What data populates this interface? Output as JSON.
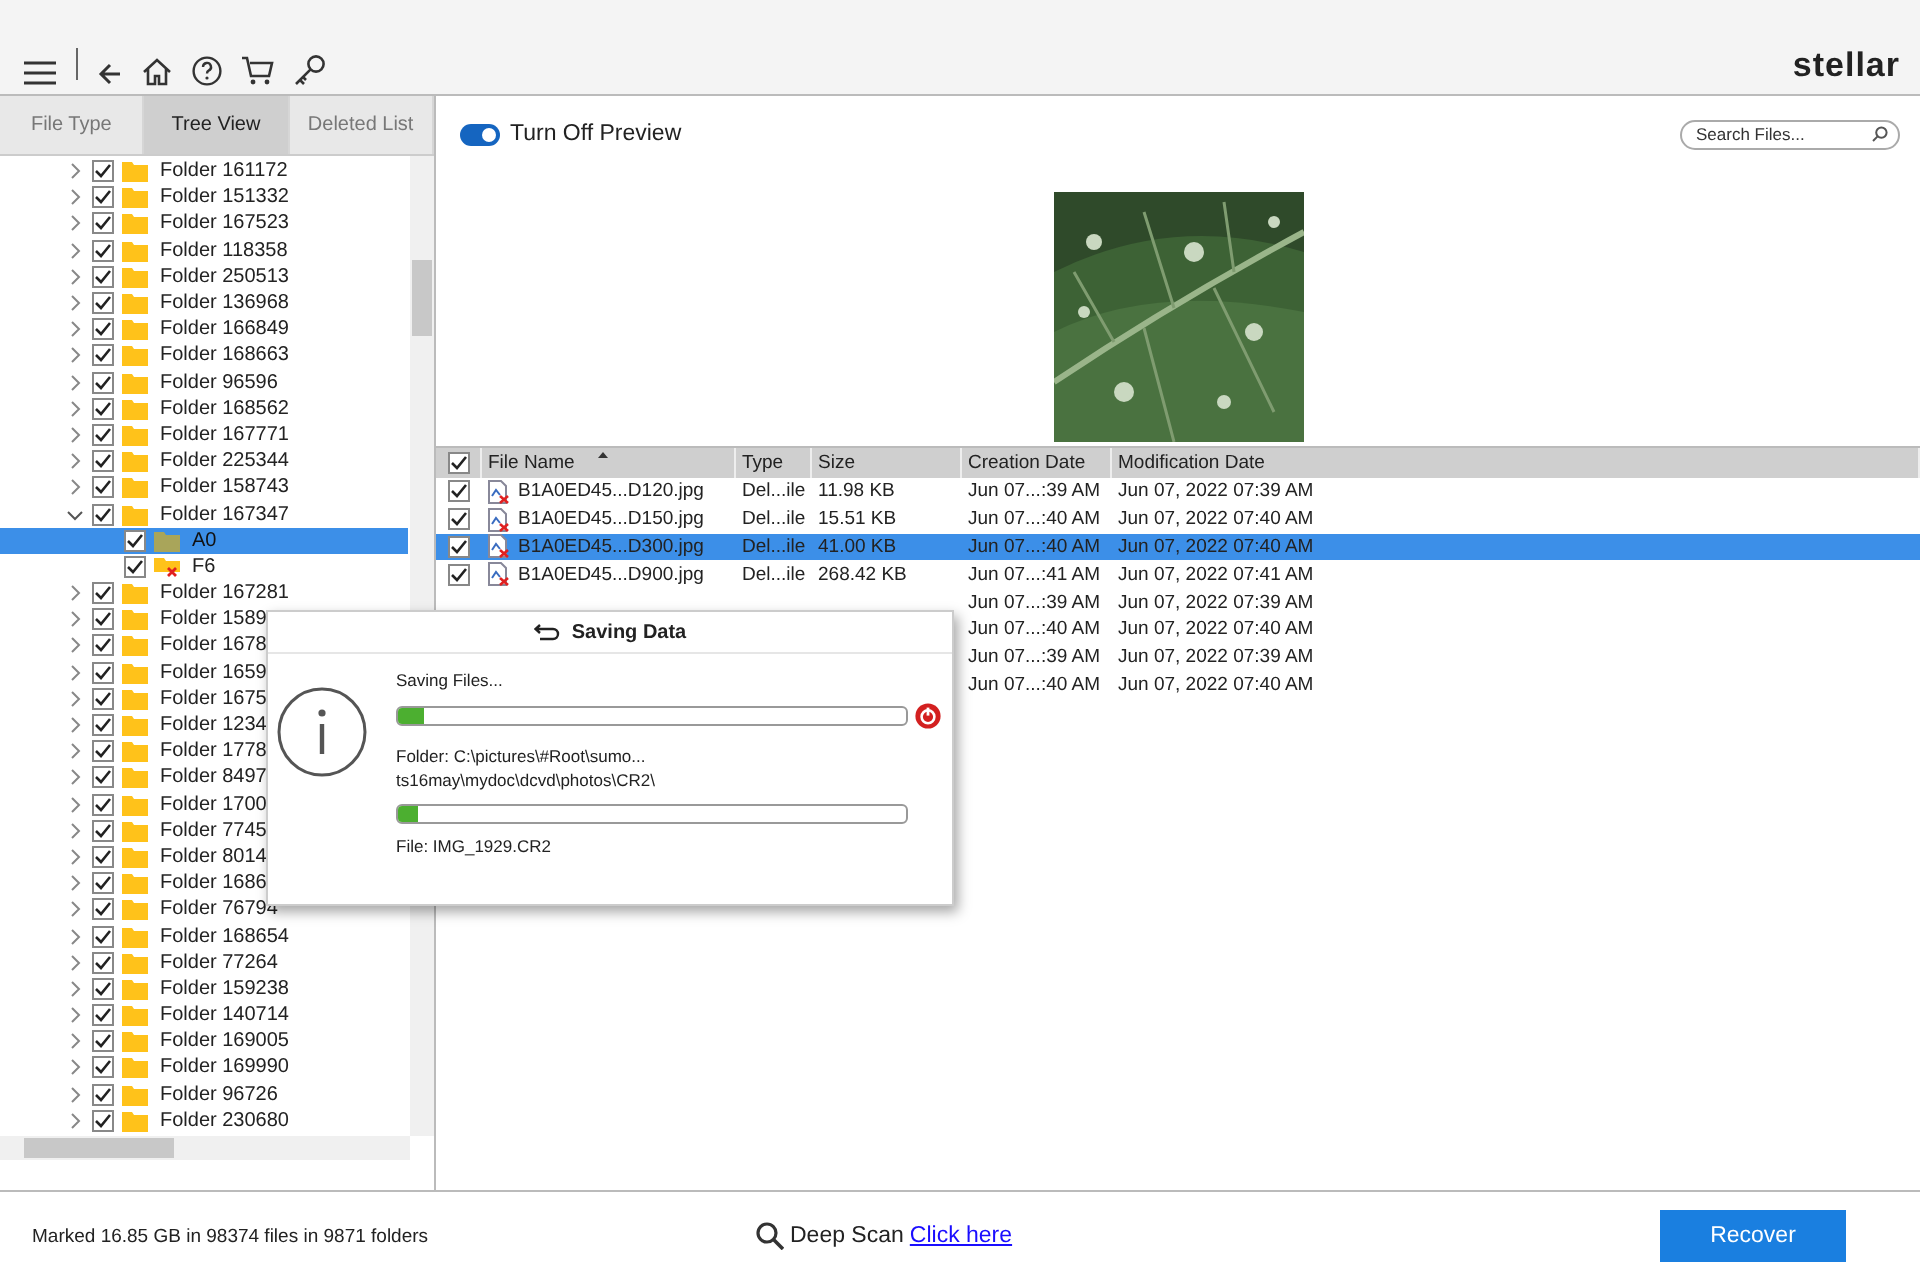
{
  "tabs": [
    {
      "label": "File Type",
      "selected": false
    },
    {
      "label": "Tree View",
      "selected": true
    },
    {
      "label": "Deleted List",
      "selected": false
    }
  ],
  "logo": "stellar",
  "tree": [
    {
      "label": "Folder 161172",
      "checked": true,
      "expanded": false,
      "selected": false,
      "kind": "folder"
    },
    {
      "label": "Folder 151332",
      "checked": true,
      "expanded": false,
      "selected": false,
      "kind": "folder"
    },
    {
      "label": "Folder 167523",
      "checked": true,
      "expanded": false,
      "selected": false,
      "kind": "folder"
    },
    {
      "label": "Folder 118358",
      "checked": true,
      "expanded": false,
      "selected": false,
      "kind": "folder"
    },
    {
      "label": "Folder 250513",
      "checked": true,
      "expanded": false,
      "selected": false,
      "kind": "folder"
    },
    {
      "label": "Folder 136968",
      "checked": true,
      "expanded": false,
      "selected": false,
      "kind": "folder"
    },
    {
      "label": "Folder 166849",
      "checked": true,
      "expanded": false,
      "selected": false,
      "kind": "folder"
    },
    {
      "label": "Folder 168663",
      "checked": true,
      "expanded": false,
      "selected": false,
      "kind": "folder"
    },
    {
      "label": "Folder 96596",
      "checked": true,
      "expanded": false,
      "selected": false,
      "kind": "folder"
    },
    {
      "label": "Folder 168562",
      "checked": true,
      "expanded": false,
      "selected": false,
      "kind": "folder"
    },
    {
      "label": "Folder 167771",
      "checked": true,
      "expanded": false,
      "selected": false,
      "kind": "folder"
    },
    {
      "label": "Folder 225344",
      "checked": true,
      "expanded": false,
      "selected": false,
      "kind": "folder"
    },
    {
      "label": "Folder 158743",
      "checked": true,
      "expanded": false,
      "selected": false,
      "kind": "folder"
    },
    {
      "label": "Folder 167347",
      "checked": true,
      "expanded": true,
      "selected": false,
      "kind": "folder",
      "children": [
        {
          "label": "A0",
          "checked": true,
          "selected": true,
          "kind": "folder"
        },
        {
          "label": "F6",
          "checked": true,
          "selected": false,
          "kind": "deleted"
        }
      ]
    },
    {
      "label": "Folder 167281",
      "checked": true,
      "expanded": false,
      "selected": false,
      "kind": "folder"
    },
    {
      "label": "Folder 1589",
      "checked": true,
      "expanded": false,
      "selected": false,
      "kind": "folder"
    },
    {
      "label": "Folder 1678",
      "checked": true,
      "expanded": false,
      "selected": false,
      "kind": "folder"
    },
    {
      "label": "Folder 1659",
      "checked": true,
      "expanded": false,
      "selected": false,
      "kind": "folder"
    },
    {
      "label": "Folder 1675",
      "checked": true,
      "expanded": false,
      "selected": false,
      "kind": "folder"
    },
    {
      "label": "Folder 1234",
      "checked": true,
      "expanded": false,
      "selected": false,
      "kind": "folder"
    },
    {
      "label": "Folder 1778",
      "checked": true,
      "expanded": false,
      "selected": false,
      "kind": "folder"
    },
    {
      "label": "Folder 8497",
      "checked": true,
      "expanded": false,
      "selected": false,
      "kind": "folder"
    },
    {
      "label": "Folder 1700",
      "checked": true,
      "expanded": false,
      "selected": false,
      "kind": "folder"
    },
    {
      "label": "Folder 7745",
      "checked": true,
      "expanded": false,
      "selected": false,
      "kind": "folder"
    },
    {
      "label": "Folder 8014",
      "checked": true,
      "expanded": false,
      "selected": false,
      "kind": "folder"
    },
    {
      "label": "Folder 1686",
      "checked": true,
      "expanded": false,
      "selected": false,
      "kind": "folder"
    },
    {
      "label": "Folder 76794",
      "checked": true,
      "expanded": false,
      "selected": false,
      "kind": "folder"
    },
    {
      "label": "Folder 168654",
      "checked": true,
      "expanded": false,
      "selected": false,
      "kind": "folder"
    },
    {
      "label": "Folder 77264",
      "checked": true,
      "expanded": false,
      "selected": false,
      "kind": "folder"
    },
    {
      "label": "Folder 159238",
      "checked": true,
      "expanded": false,
      "selected": false,
      "kind": "folder"
    },
    {
      "label": "Folder 140714",
      "checked": true,
      "expanded": false,
      "selected": false,
      "kind": "folder"
    },
    {
      "label": "Folder 169005",
      "checked": true,
      "expanded": false,
      "selected": false,
      "kind": "folder"
    },
    {
      "label": "Folder 169990",
      "checked": true,
      "expanded": false,
      "selected": false,
      "kind": "folder"
    },
    {
      "label": "Folder 96726",
      "checked": true,
      "expanded": false,
      "selected": false,
      "kind": "folder"
    },
    {
      "label": "Folder 230680",
      "checked": true,
      "expanded": false,
      "selected": false,
      "kind": "folder"
    }
  ],
  "preview_toggle": {
    "label": "Turn Off Preview",
    "on": true
  },
  "search": {
    "placeholder": "Search Files..."
  },
  "table": {
    "all_checked": true,
    "columns": [
      "File Name",
      "Type",
      "Size",
      "Creation Date",
      "Modification Date"
    ],
    "rows": [
      {
        "checked": true,
        "selected": false,
        "name": "B1A0ED45...D120.jpg",
        "type": "Del...ile",
        "size": "11.98 KB",
        "created": "Jun 07...:39 AM",
        "modified": "Jun 07, 2022 07:39 AM"
      },
      {
        "checked": true,
        "selected": false,
        "name": "B1A0ED45...D150.jpg",
        "type": "Del...ile",
        "size": "15.51 KB",
        "created": "Jun 07...:40 AM",
        "modified": "Jun 07, 2022 07:40 AM"
      },
      {
        "checked": true,
        "selected": true,
        "name": "B1A0ED45...D300.jpg",
        "type": "Del...ile",
        "size": "41.00 KB",
        "created": "Jun 07...:40 AM",
        "modified": "Jun 07, 2022 07:40 AM"
      },
      {
        "checked": true,
        "selected": false,
        "name": "B1A0ED45...D900.jpg",
        "type": "Del...ile",
        "size": "268.42 KB",
        "created": "Jun 07...:41 AM",
        "modified": "Jun 07, 2022 07:41 AM"
      },
      {
        "created": "Jun 07...:39 AM",
        "modified": "Jun 07, 2022 07:39 AM"
      },
      {
        "created": "Jun 07...:40 AM",
        "modified": "Jun 07, 2022 07:40 AM"
      },
      {
        "created": "Jun 07...:39 AM",
        "modified": "Jun 07, 2022 07:39 AM"
      },
      {
        "created": "Jun 07...:40 AM",
        "modified": "Jun 07, 2022 07:40 AM"
      }
    ]
  },
  "dialog": {
    "title": "Saving Data",
    "status": "Saving Files...",
    "progress": {
      "level": 0.05
    },
    "folder": "Folder: C:\\pictures\\#Root\\sumo...\nts16may\\mydoc\\dcvd\\photos\\CR2\\",
    "file_progress": {
      "level": 0.04
    },
    "file": "File: IMG_1929.CR2"
  },
  "status_bar": {
    "marked": "Marked 16.85 GB in 98374 files in 9871 folders",
    "deep_scan": "Deep Scan",
    "link": "Click here",
    "button": "Recover"
  }
}
